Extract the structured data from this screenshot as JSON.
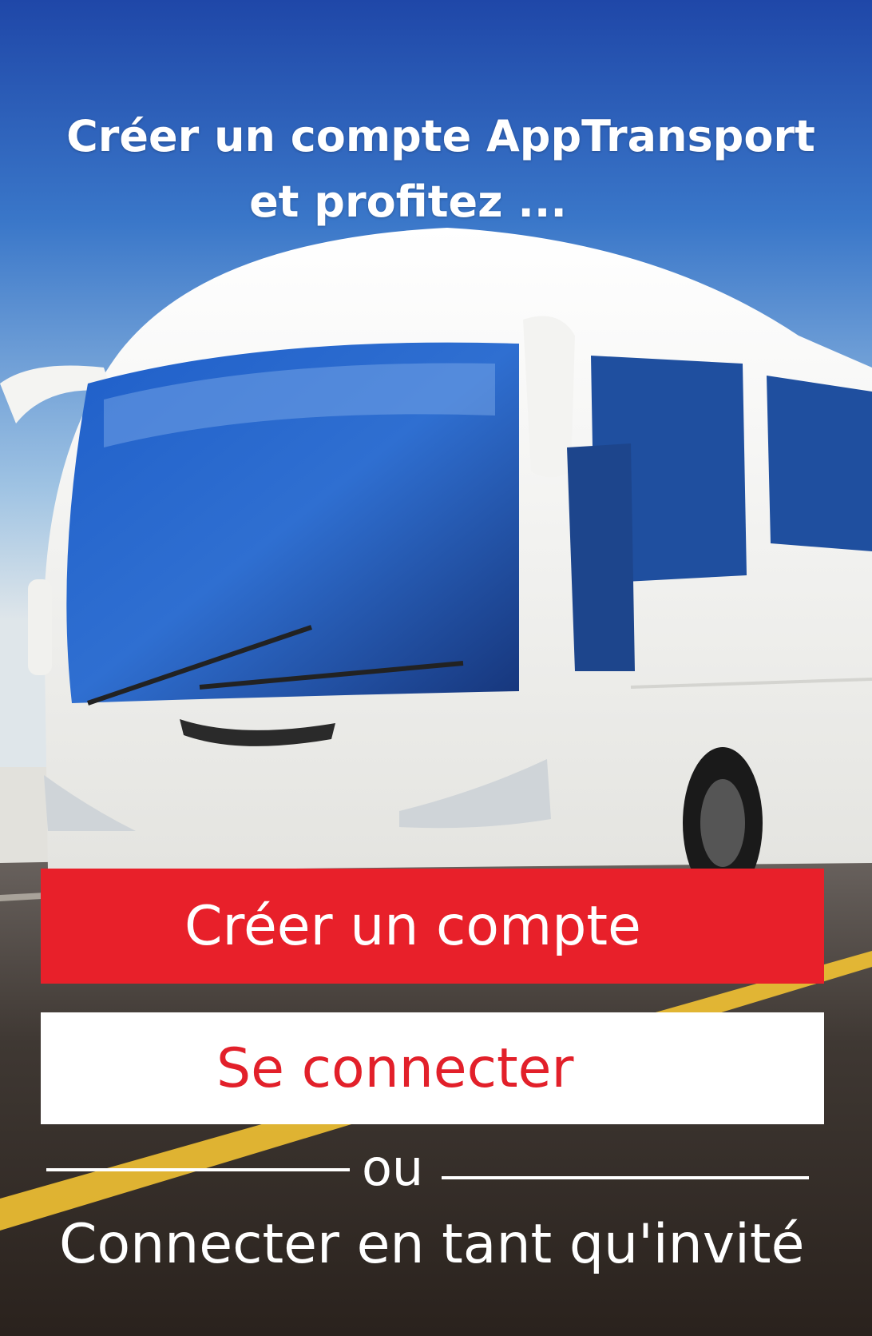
{
  "headline": {
    "line1": "Créer un compte AppTransport",
    "line2": "et profitez ..."
  },
  "background": {
    "subject": "white coach bus on highway",
    "sky_color": "#2a5db8",
    "road_color": "#3a3430",
    "lane_color": "#f2c233"
  },
  "buttons": {
    "create_account": "Créer un compte",
    "login": "Se connecter"
  },
  "separator": {
    "text": "ou"
  },
  "guest_link": "Connecter en tant qu'invité",
  "colors": {
    "accent_red": "#e8202a",
    "text_white": "#ffffff"
  }
}
